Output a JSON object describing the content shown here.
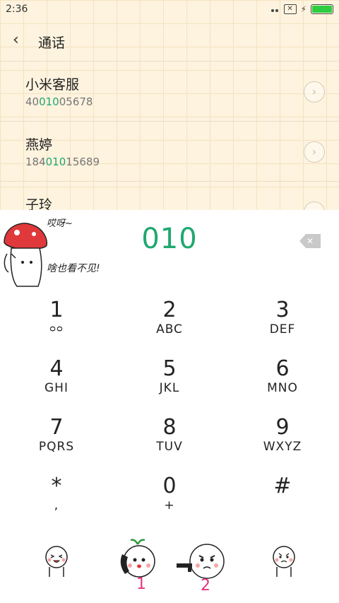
{
  "status": {
    "time": "2:36"
  },
  "header": {
    "title": "通话"
  },
  "contacts": [
    {
      "name": "小米客服",
      "number_prefix": "40",
      "number_match": "010",
      "number_suffix": "05678"
    },
    {
      "name": "燕婷",
      "number_prefix": "184",
      "number_match": "010",
      "number_suffix": "15689"
    },
    {
      "name": "子玲",
      "number_prefix": "",
      "number_match": "",
      "number_suffix": ""
    }
  ],
  "dialer": {
    "input_value": "010",
    "sticker_text_1": "哎呀~",
    "sticker_text_2": "啥也看不见!"
  },
  "keypad": [
    {
      "num": "1",
      "sub": "ᴗᴗ"
    },
    {
      "num": "2",
      "sub": "ABC"
    },
    {
      "num": "3",
      "sub": "DEF"
    },
    {
      "num": "4",
      "sub": "GHI"
    },
    {
      "num": "5",
      "sub": "JKL"
    },
    {
      "num": "6",
      "sub": "MNO"
    },
    {
      "num": "7",
      "sub": "PQRS"
    },
    {
      "num": "8",
      "sub": "TUV"
    },
    {
      "num": "9",
      "sub": "WXYZ"
    },
    {
      "num": "*",
      "sub": ","
    },
    {
      "num": "0",
      "sub": "+"
    },
    {
      "num": "#",
      "sub": ""
    }
  ],
  "bottom_bar": {
    "sim1_label": "1",
    "sim2_label": "2",
    "colors": {
      "accent": "#1fa870",
      "sim_pink": "#e8337a"
    }
  }
}
